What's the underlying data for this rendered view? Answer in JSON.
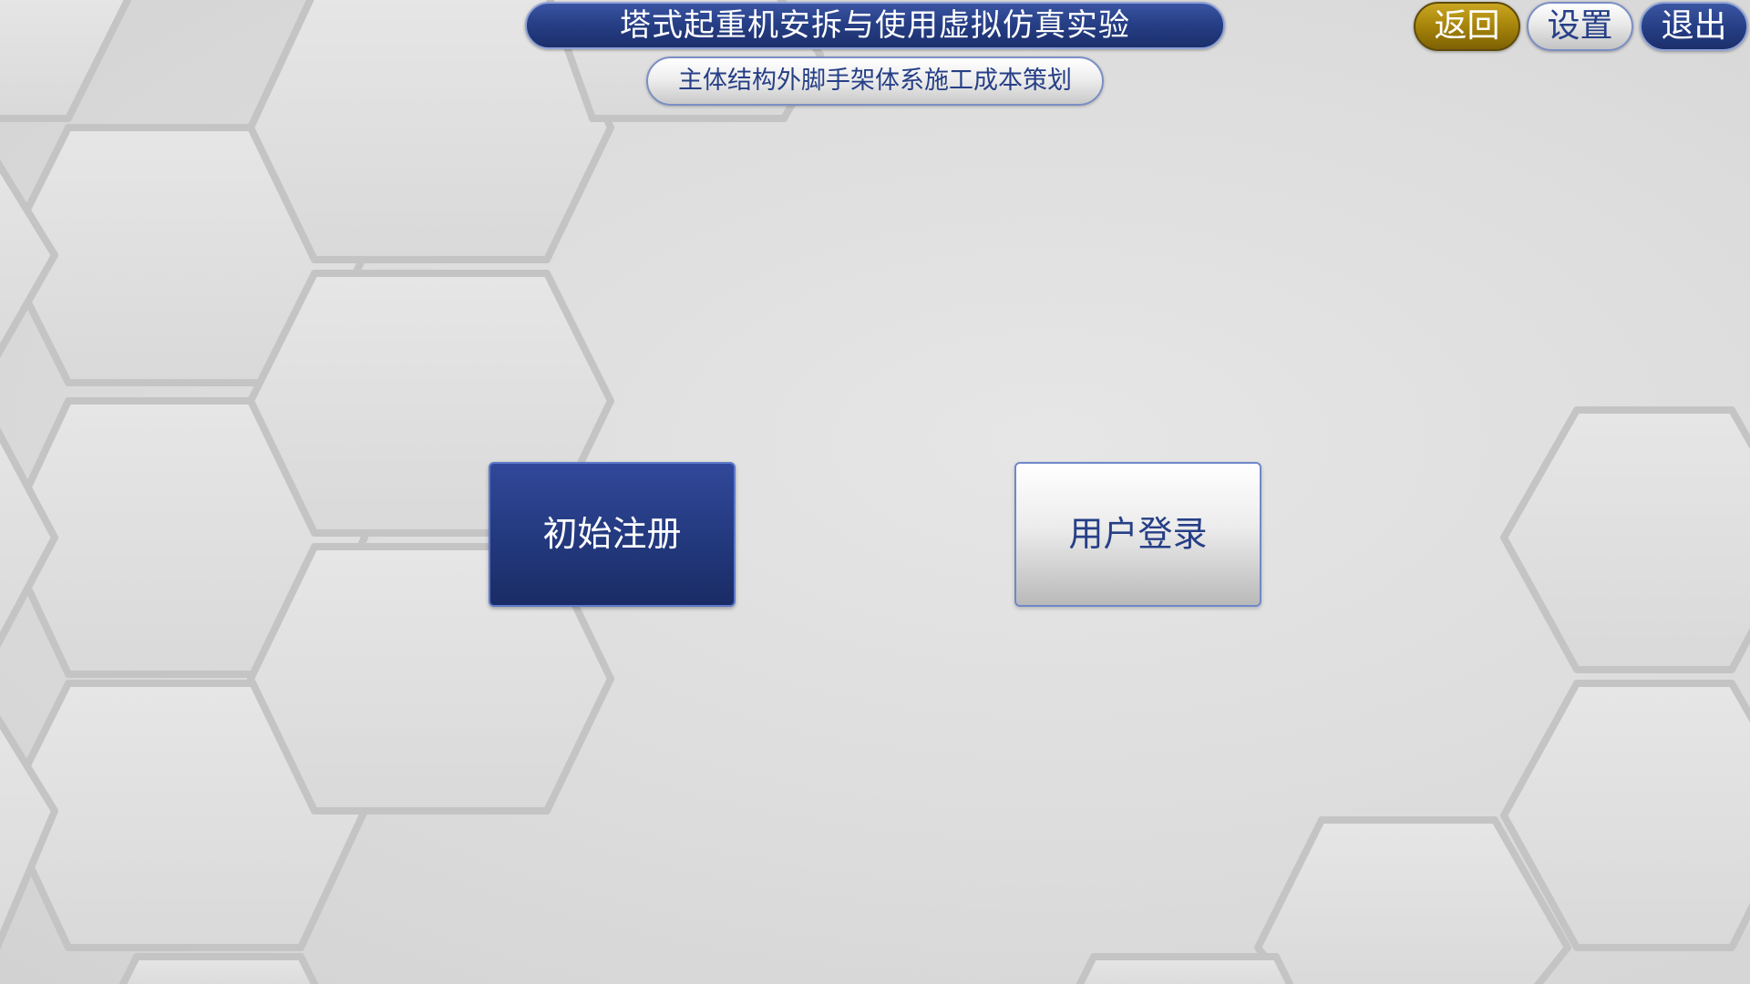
{
  "header": {
    "title": "塔式起重机安拆与使用虚拟仿真实验",
    "subtitle": "主体结构外脚手架体系施工成本策划"
  },
  "top_buttons": {
    "back_label": "返回",
    "settings_label": "设置",
    "exit_label": "退出"
  },
  "main": {
    "register_label": "初始注册",
    "login_label": "用户登录"
  },
  "colors": {
    "primary_navy": "#263f86",
    "accent_gold": "#a6840a",
    "background_gray": "#dcdcdc"
  }
}
